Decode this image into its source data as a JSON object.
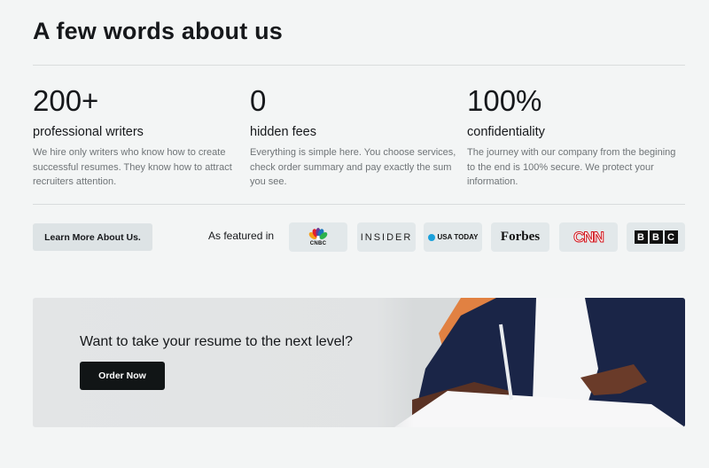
{
  "section": {
    "title": "A few words about us"
  },
  "stats": [
    {
      "number": "200+",
      "label": "professional writers",
      "description": "We hire only writers who know how to create successful resumes. They know how to attract recruiters attention."
    },
    {
      "number": "0",
      "label": "hidden fees",
      "description": "Everything is simple here. You choose services, check order summary and pay exactly the sum you see."
    },
    {
      "number": "100%",
      "label": "confidentiality",
      "description": "The journey with our company from the begining to the end is 100% secure. We protect your information."
    }
  ],
  "featured": {
    "learn_more_label": "Learn More About Us.",
    "label": "As featured in",
    "logos": {
      "cnbc": "CNBC",
      "insider": "INSIDER",
      "usatoday": "USA TODAY",
      "forbes": "Forbes",
      "cnn": "CNN",
      "bbc": [
        "B",
        "B",
        "C"
      ]
    }
  },
  "banner": {
    "headline": "Want to take your resume to the next level?",
    "cta_label": "Order Now"
  },
  "colors": {
    "background": "#f3f5f5",
    "button_dark": "#111516",
    "button_light": "#dde3e5",
    "cnn_red": "#d2161d",
    "usatoday_blue": "#1aa0db"
  }
}
